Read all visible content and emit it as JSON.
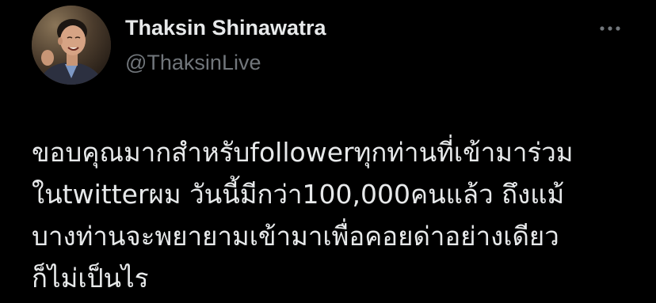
{
  "author": {
    "display_name": "Thaksin Shinawatra",
    "handle": "@ThaksinLive",
    "avatar_icon": "profile-photo"
  },
  "more_menu_icon": "more-horizontal-icon",
  "tweet": {
    "lines": [
      "ขอบคุณมากสำหรับfollowerทุกท่านที่เข้ามาร่วม",
      "ในtwitterผม วันนี้มีกว่า100,000คนแล้ว ถึงแม้",
      "บางท่านจะพยายามเข้ามาเพื่อคอยด่าอย่างเดียว",
      "ก็ไม่เป็นไร"
    ]
  },
  "colors": {
    "background": "#000000",
    "primary_text": "#e7e9ea",
    "secondary_text": "#71767b"
  }
}
